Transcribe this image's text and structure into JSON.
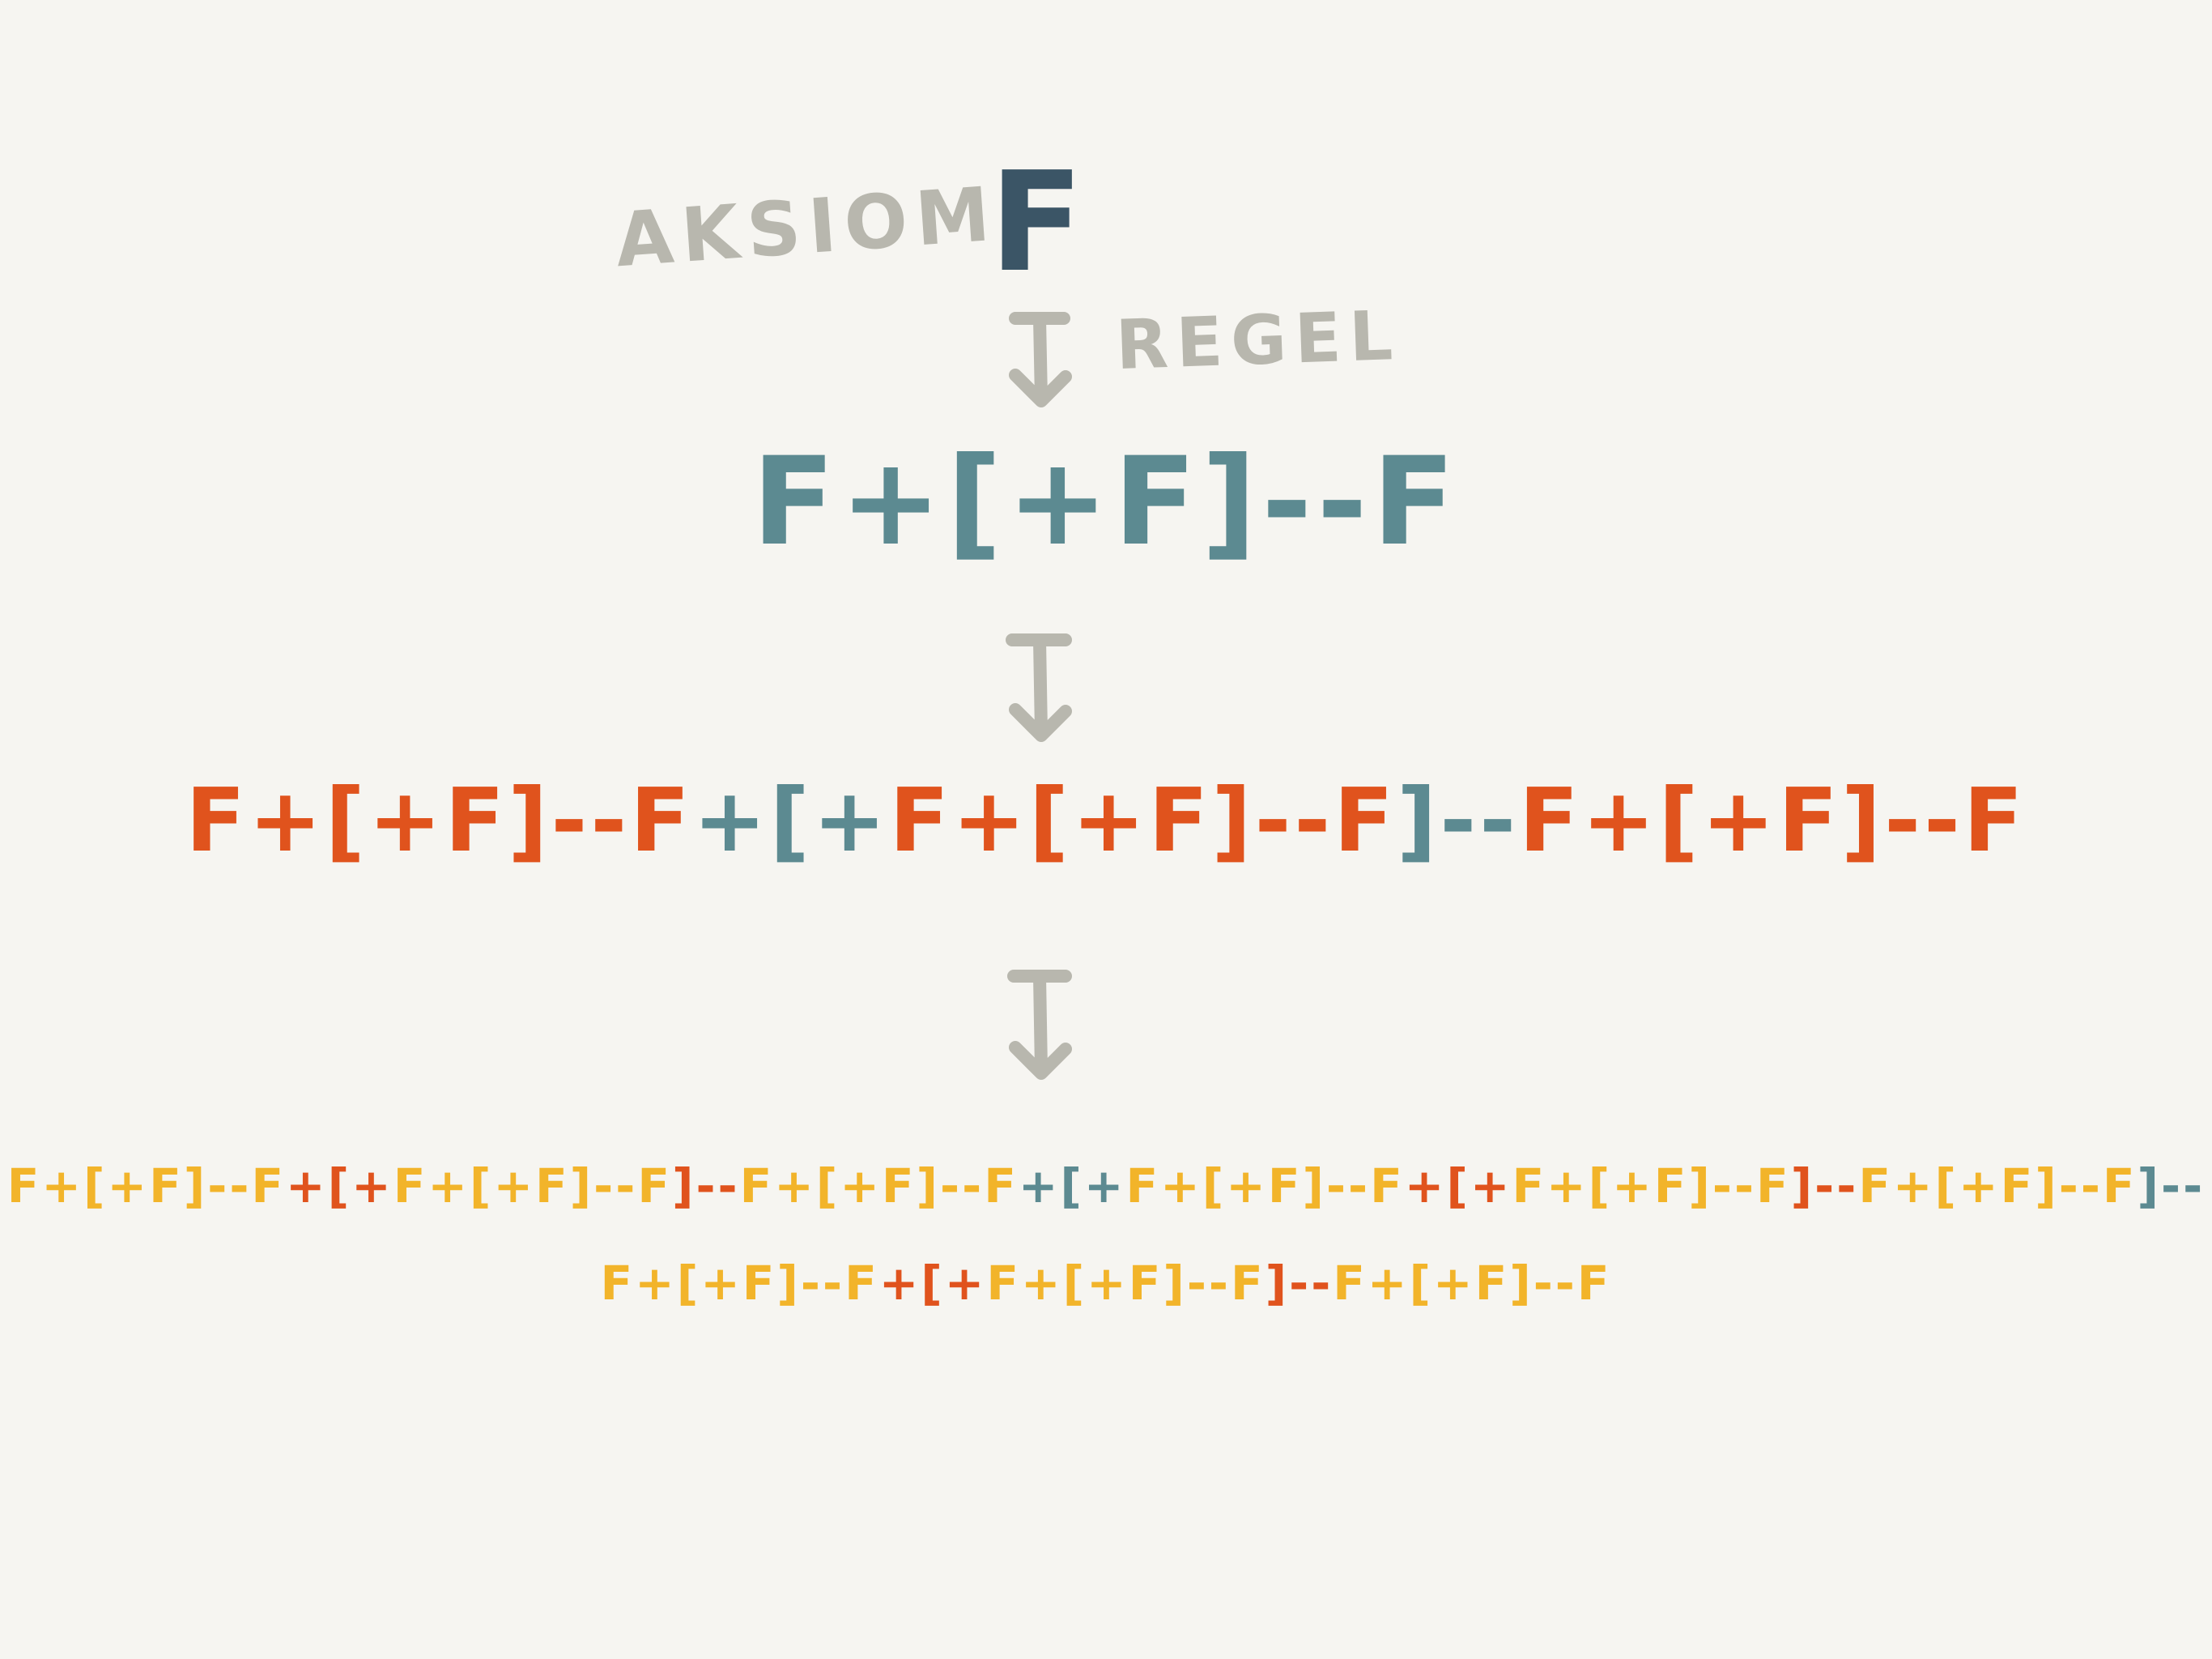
{
  "axiom": {
    "label": "AKSIOM",
    "value": "F",
    "label_color": "#b8b7ae",
    "value_color": "#3b5566"
  },
  "rule": {
    "label": "REGEL",
    "color": "#b8b7ae"
  },
  "arrow": {
    "color": "#b8b7ae",
    "icon": "down-arrow-icon"
  },
  "colors": {
    "teal": "#5c8a91",
    "orange": "#e0531d",
    "yellow": "#f2b42a"
  },
  "generations": [
    {
      "name": "gen1",
      "lines": [
        [
          [
            "teal",
            "F+[+F]--F"
          ]
        ]
      ]
    },
    {
      "name": "gen2",
      "lines": [
        [
          [
            "orange",
            "F+[+F]--F"
          ],
          [
            "teal",
            "+["
          ],
          [
            "teal",
            "+"
          ],
          [
            "orange",
            "F+[+F]--F"
          ],
          [
            "teal",
            "]--"
          ],
          [
            "orange",
            "F+[+F]--F"
          ]
        ]
      ]
    },
    {
      "name": "gen3",
      "lines": [
        [
          [
            "yellow",
            "F+[+F]--F"
          ],
          [
            "orange",
            "+[+"
          ],
          [
            "yellow",
            "F+[+F]--F"
          ],
          [
            "orange",
            "]--"
          ],
          [
            "yellow",
            "F+[+F]--F"
          ],
          [
            "teal",
            "+[+"
          ],
          [
            "yellow",
            "F+[+F]--F"
          ],
          [
            "orange",
            "+[+"
          ],
          [
            "yellow",
            "F+[+F]--F"
          ],
          [
            "orange",
            "]--"
          ],
          [
            "yellow",
            "F+[+F]--F"
          ],
          [
            "teal",
            "]--"
          ]
        ],
        [
          [
            "yellow",
            "F+[+F]--F"
          ],
          [
            "orange",
            "+[+"
          ],
          [
            "yellow",
            "F+[+F]--F"
          ],
          [
            "orange",
            "]--"
          ],
          [
            "yellow",
            "F+[+F]--F"
          ]
        ]
      ]
    }
  ]
}
